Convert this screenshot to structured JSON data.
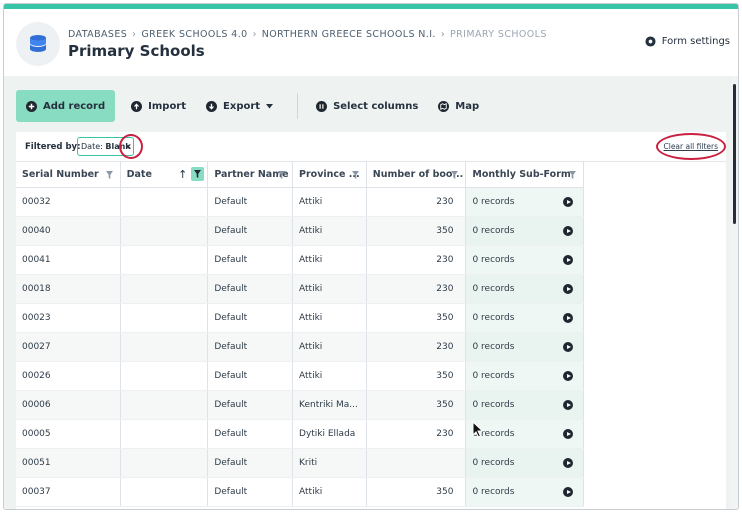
{
  "breadcrumb": {
    "items": [
      "DATABASES",
      "GREEK SCHOOLS 4.0",
      "NORTHERN GREECE SCHOOLS N.I.",
      "PRIMARY SCHOOLS"
    ],
    "separator": "›"
  },
  "page": {
    "title": "Primary Schools"
  },
  "header": {
    "form_settings_label": "Form settings"
  },
  "toolbar": {
    "add_record": "Add record",
    "import": "Import",
    "export": "Export",
    "select_columns": "Select columns",
    "map": "Map"
  },
  "filters": {
    "label": "Filtered by:",
    "chip_field": "Date:",
    "chip_value": "Blank",
    "chip_remove": "×",
    "clear_all": "Clear all filters"
  },
  "table": {
    "columns": [
      "Serial Number",
      "Date",
      "Partner Name",
      "Province ...",
      "Number of boo...",
      "Monthly Sub-Form"
    ],
    "sort_indicator": "↑",
    "rows": [
      {
        "serial": "00032",
        "date": "",
        "partner": "Default",
        "province": "Attiki",
        "books": "230",
        "sub": "0 records"
      },
      {
        "serial": "00040",
        "date": "",
        "partner": "Default",
        "province": "Attiki",
        "books": "350",
        "sub": "0 records"
      },
      {
        "serial": "00041",
        "date": "",
        "partner": "Default",
        "province": "Attiki",
        "books": "230",
        "sub": "0 records"
      },
      {
        "serial": "00018",
        "date": "",
        "partner": "Default",
        "province": "Attiki",
        "books": "230",
        "sub": "0 records"
      },
      {
        "serial": "00023",
        "date": "",
        "partner": "Default",
        "province": "Attiki",
        "books": "350",
        "sub": "0 records"
      },
      {
        "serial": "00027",
        "date": "",
        "partner": "Default",
        "province": "Attiki",
        "books": "230",
        "sub": "0 records"
      },
      {
        "serial": "00026",
        "date": "",
        "partner": "Default",
        "province": "Attiki",
        "books": "350",
        "sub": "0 records"
      },
      {
        "serial": "00006",
        "date": "",
        "partner": "Default",
        "province": "Kentriki Ma...",
        "books": "350",
        "sub": "0 records"
      },
      {
        "serial": "00005",
        "date": "",
        "partner": "Default",
        "province": "Dytiki Ellada",
        "books": "230",
        "sub": "0 records"
      },
      {
        "serial": "00051",
        "date": "",
        "partner": "Default",
        "province": "Kriti",
        "books": "",
        "sub": "0 records"
      },
      {
        "serial": "00037",
        "date": "",
        "partner": "Default",
        "province": "Attiki",
        "books": "350",
        "sub": "0 records"
      }
    ]
  },
  "colors": {
    "accent": "#38c4a6",
    "accent_light": "#88dcc2",
    "highlight_circle": "#c8203e"
  },
  "icons": [
    "database-icon",
    "gear-icon",
    "plus-circle-icon",
    "upload-icon",
    "download-icon",
    "columns-icon",
    "map-icon",
    "filter-icon",
    "play-icon"
  ]
}
